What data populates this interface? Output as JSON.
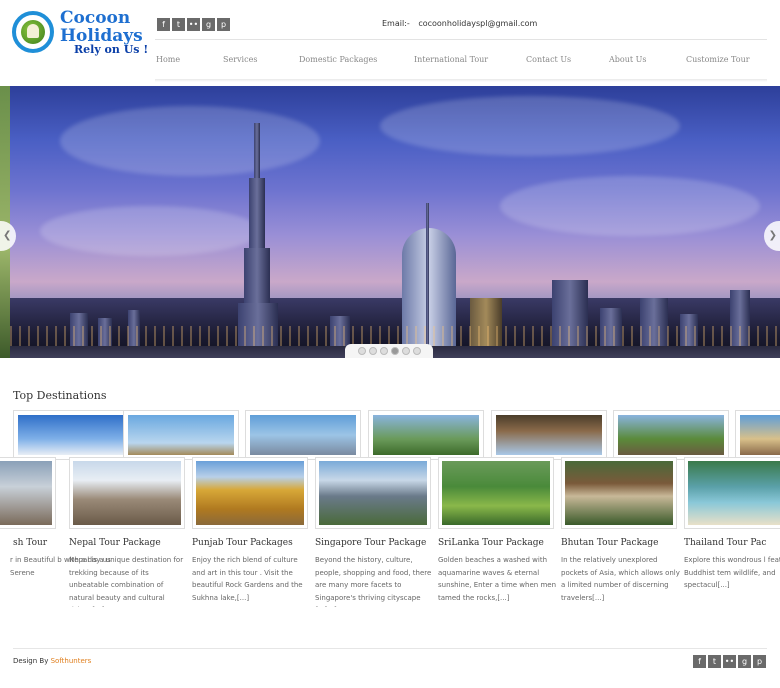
{
  "brand": {
    "name_line1": "Cocoon",
    "name_line2": "Holidays",
    "tagline": "Rely on Us !"
  },
  "social": [
    {
      "icon": "facebook-icon",
      "glyph": "f"
    },
    {
      "icon": "twitter-icon",
      "glyph": "t"
    },
    {
      "icon": "flickr-icon",
      "glyph": "••"
    },
    {
      "icon": "google-plus-icon",
      "glyph": "g"
    },
    {
      "icon": "pinterest-icon",
      "glyph": "p"
    }
  ],
  "contact": {
    "email_label": "Email:-",
    "email": "cocoonholidayspl@gmail.com"
  },
  "nav": [
    {
      "label": "Home"
    },
    {
      "label": "Services"
    },
    {
      "label": "Domestic Packages"
    },
    {
      "label": "International Tour"
    },
    {
      "label": "Contact Us"
    },
    {
      "label": "About Us"
    },
    {
      "label": "Customize Tour"
    }
  ],
  "slider": {
    "prev_glyph": "❮",
    "next_glyph": "❯",
    "dot_count": 6,
    "active_dot": 4
  },
  "destinations": {
    "title": "Top Destinations",
    "cards": [
      {
        "title": "sh Tour",
        "text": "r in Beautiful b with a day us Serene",
        "more": ""
      },
      {
        "title": "Nepal Tour Package",
        "text": "Nepal is a unique destination for trekking because of its unbeatable combination of natural beauty and cultural riches.",
        "more": "[...]"
      },
      {
        "title": "Punjab Tour Packages",
        "text": "Enjoy the rich blend of culture and art in this tour . Visit the beautiful Rock Gardens and the Sukhna lake,",
        "more": "[...]"
      },
      {
        "title": "Singapore Tour Package",
        "text": "Beyond the history, culture, people, shopping and food, there are many more facets to Singapore's thriving cityscape for",
        "more": "[...]"
      },
      {
        "title": "SriLanka Tour Package",
        "text": "Golden beaches a washed with aquamarine waves & eternal sunshine, Enter a time when men tamed the rocks,",
        "more": "[...]"
      },
      {
        "title": "Bhutan Tour Package",
        "text": "In the relatively unexplored pockets of Asia, which allows only a limited number of discerning travelers",
        "more": "[...]"
      },
      {
        "title": "Thailand Tour Pac",
        "text": "Explore this wondrous l featuring Buddhist tem wildlife, and spectacul",
        "more": "[...]"
      }
    ]
  },
  "footer": {
    "credit_prefix": "Design By",
    "credit_brand": "Softhunters"
  },
  "colors": {
    "brand_blue": "#1e6fd0",
    "credit_orange": "#e08020"
  }
}
